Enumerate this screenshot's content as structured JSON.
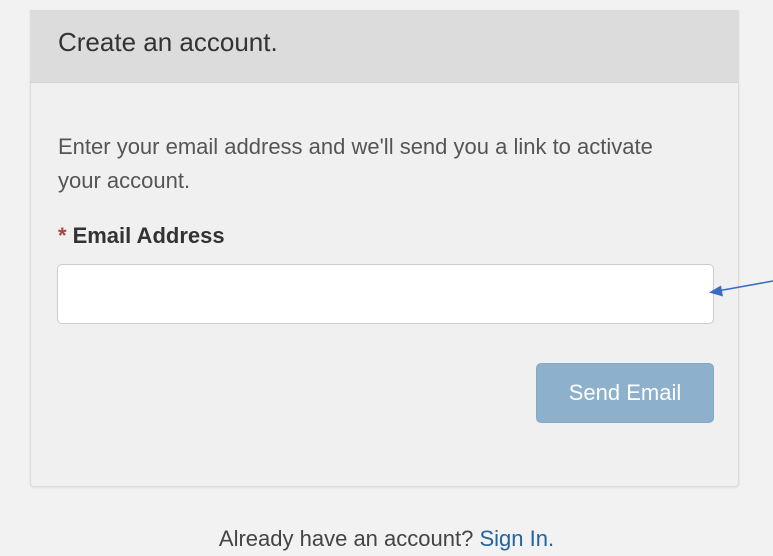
{
  "panel": {
    "title": "Create an account.",
    "intro": "Enter your email address and we'll send you a link to activate your account."
  },
  "email_field": {
    "required_marker": "*",
    "label": "Email Address",
    "value": "",
    "placeholder": ""
  },
  "send_button": {
    "label": "Send Email",
    "state": "disabled"
  },
  "footer": {
    "prompt": "Already have an account?",
    "signin_label": "Sign In."
  },
  "annotation": {
    "arrow_color": "#3a6cc4"
  },
  "colors": {
    "page_bg": "#f2f2f2",
    "header_bg": "#dcdcdc",
    "required_star": "#a94442",
    "button_bg": "#8db1cd",
    "link": "#23639e"
  }
}
